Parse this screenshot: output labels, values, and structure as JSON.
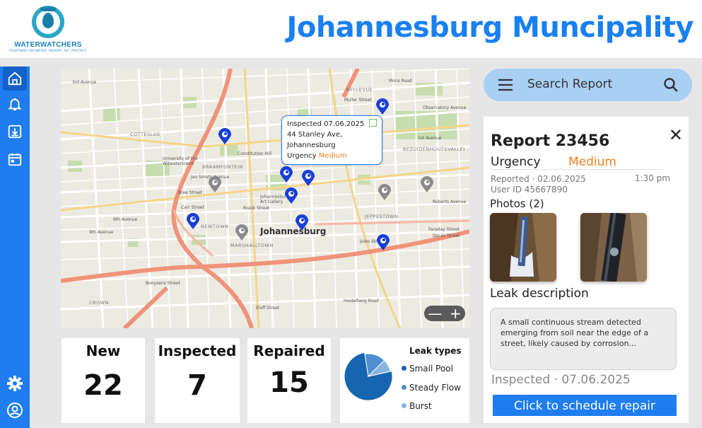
{
  "brand": {
    "name": "WATERWATCHERS",
    "tagline": "TOGETHER FOR WATER. REPORT. ALT. PROTECT.",
    "accent": "#1f7df0"
  },
  "header": {
    "title": "Johannesburg Muncipality"
  },
  "sidebar": {
    "items": [
      {
        "icon": "home-icon",
        "active": true
      },
      {
        "icon": "bell-icon",
        "active": false
      },
      {
        "icon": "download-icon",
        "active": false
      },
      {
        "icon": "calendar-icon",
        "active": false
      },
      {
        "icon": "gear-icon",
        "active": false
      },
      {
        "icon": "user-icon",
        "active": false
      }
    ]
  },
  "map": {
    "city_label": "Johannesburg",
    "labels": [
      "3rd Avenue",
      "BELLEVUE",
      "Muller Street",
      "Observatory Avenue",
      "COTTESLOE",
      "University of the Witwatersrand",
      "Constitution Hill",
      "BRAAMFONTEIN",
      "1st Avenue",
      "BEZUIDENHOUTSVALLEI",
      "Johannesburg Art Gallery",
      "Carr Street",
      "NEWTOWN",
      "JEPPESTOWN",
      "Roberts Avenue",
      "6th Avenue",
      "MARSHALLTOWN",
      "Jules Street",
      "CROWN",
      "Booysens Street",
      "Eloff Street",
      "Heidelberg Road",
      "Faraday Street",
      "Doran Street",
      "Mons Road",
      "9th Avenue",
      "Bree Street",
      "Jan Smuts Avenue",
      "Rissik Street"
    ],
    "popup": {
      "status": "Inspected 07.06.2025",
      "address_line1": "44 Stanley Ave,",
      "address_line2": "Johannesburg",
      "urgency_label": "Urgency",
      "urgency_value": "Medium"
    },
    "zoom": {
      "minus": "—",
      "plus": "+"
    }
  },
  "stats": [
    {
      "label": "New",
      "value": "22"
    },
    {
      "label": "Inspected",
      "value": "7"
    },
    {
      "label": "Repaired",
      "value": "15"
    }
  ],
  "chart_data": {
    "type": "pie",
    "title": "Leak types",
    "categories": [
      "Small Pool",
      "Steady Flow",
      "Burst"
    ],
    "values": [
      76,
      15,
      9
    ],
    "colors": [
      "#1565b0",
      "#4f8fcf",
      "#86b6e0"
    ]
  },
  "search": {
    "placeholder": "Search Report"
  },
  "report": {
    "title": "Report 23456",
    "urgency_label": "Urgency",
    "urgency_value": "Medium",
    "reported": "Reported  · 02.06.2025",
    "time": "1:30 pm",
    "user_id": "User ID 45667890",
    "photos_label": "Photos (2)",
    "leak_label": "Leak description",
    "description": "A small continuous stream detected emerging from soil near the edge of a street, likely caused by corrosion...",
    "status": "Inspected   · 07.06.2025",
    "schedule_button": "Click to schedule repair",
    "close": "✕"
  }
}
